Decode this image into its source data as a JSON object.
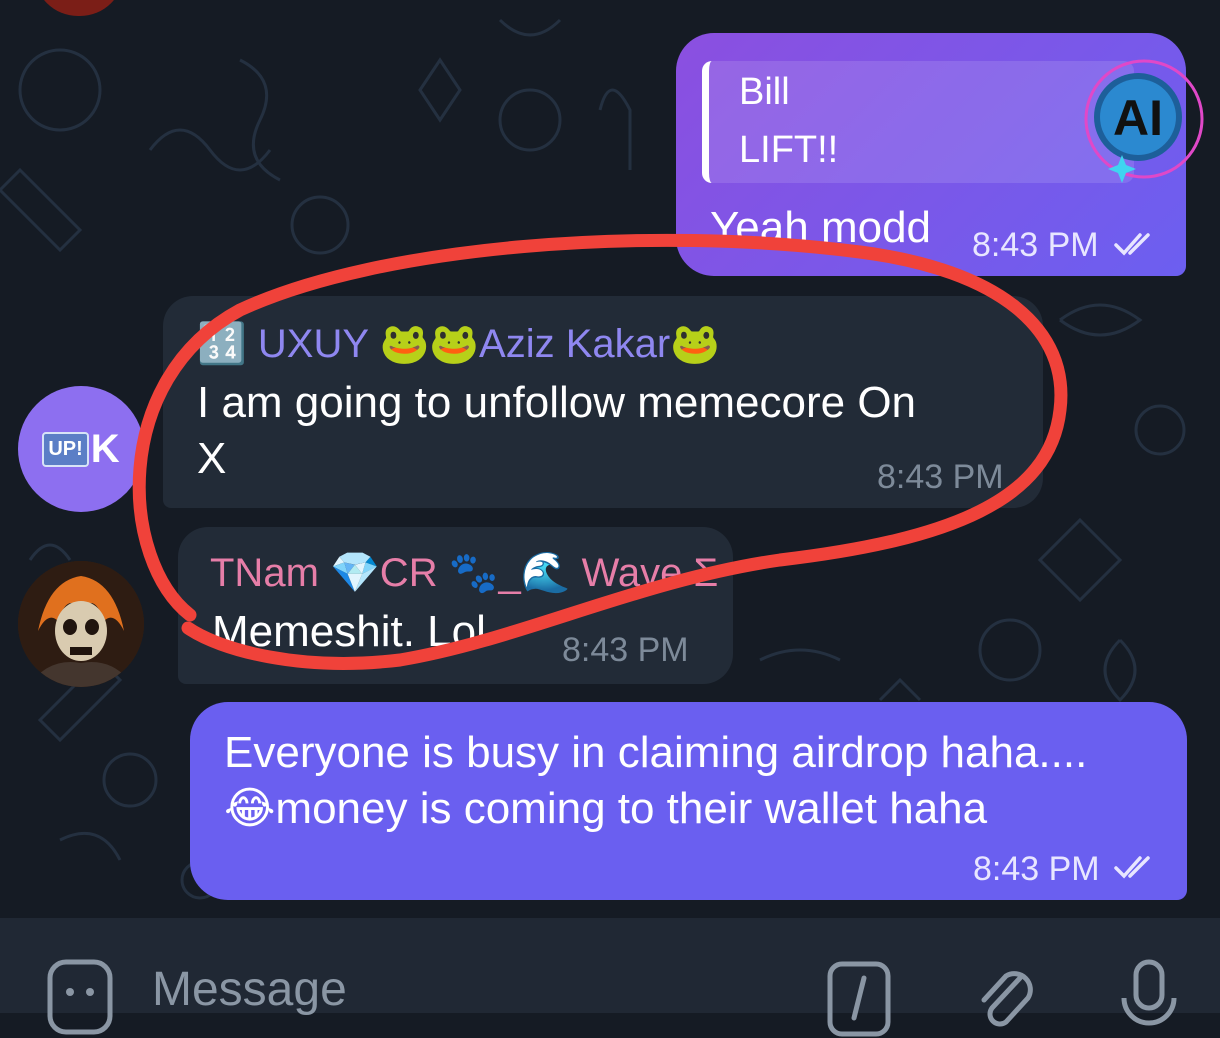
{
  "messages": [
    {
      "direction": "outgoing",
      "reply": {
        "name": "Bill",
        "text": "LIFT!!"
      },
      "text": "Yeah modd",
      "time": "8:43 PM",
      "status": "read"
    },
    {
      "direction": "incoming",
      "sender": "🔢 UXUY 🐸🐸Aziz Kakar🐸",
      "avatar_text": {
        "badge": "UP!",
        "letter": "K"
      },
      "text_line1": "I am going to unfollow memecore On",
      "text_line2": "X",
      "time": "8:43 PM"
    },
    {
      "direction": "incoming",
      "sender": "TNam 💎CR 🐾_🌊 Wave Σ",
      "avatar": "ghost-rider-avatar",
      "text": "Memeshit. Lol",
      "time": "8:43 PM"
    },
    {
      "direction": "outgoing",
      "text_line1": "Everyone is busy in claiming airdrop haha....",
      "text_line2": "😂money is coming to their wallet haha",
      "time": "8:43 PM",
      "status": "read"
    }
  ],
  "badge": {
    "label": "AI"
  },
  "input": {
    "placeholder": "Message"
  },
  "icons": [
    "emoji-icon",
    "command-icon",
    "attach-icon",
    "mic-icon",
    "double-check-icon",
    "ai-badge-icon"
  ],
  "colors": {
    "outgoing_bubble": "#6a5ff0",
    "incoming_bubble": "#222b37",
    "background": "#151b24",
    "annotation": "#f0423a"
  }
}
